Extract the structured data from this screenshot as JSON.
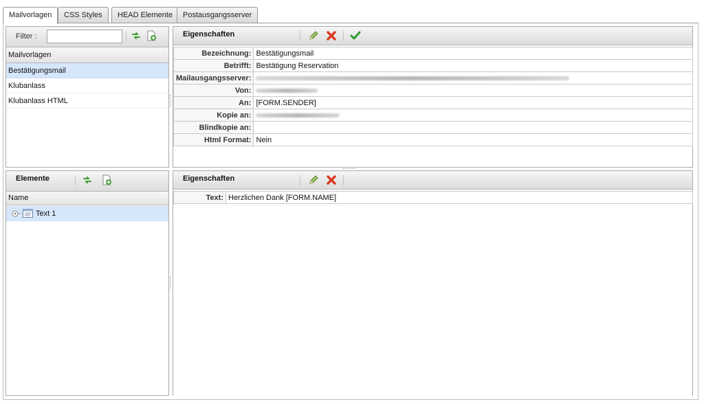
{
  "tabs": [
    {
      "label": "Mailvorlagen",
      "active": true
    },
    {
      "label": "CSS Styles",
      "active": false
    },
    {
      "label": "HEAD Elemente",
      "active": false
    },
    {
      "label": "Postausgangsserver",
      "active": false
    }
  ],
  "templates_panel": {
    "filter_label": "Filter :",
    "filter_value": "",
    "column_header": "Mailvorlagen",
    "items": [
      "Bestätigungsmail",
      "Klubanlass",
      "Klubanlass HTML"
    ],
    "selected_index": 0
  },
  "template_props": {
    "title": "Eigenschaften",
    "rows": [
      {
        "key": "Bezeichnung:",
        "value": "Bestätigungsmail"
      },
      {
        "key": "Betrifft:",
        "value": "Bestätigung Reservation"
      },
      {
        "key": "Mailausgangsserver:",
        "value": ""
      },
      {
        "key": "Von:",
        "value": ""
      },
      {
        "key": "An:",
        "value": "[FORM.SENDER]"
      },
      {
        "key": "Kopie an:",
        "value": ""
      },
      {
        "key": "Blindkopie an:",
        "value": ""
      },
      {
        "key": "Html Format:",
        "value": "Nein"
      }
    ]
  },
  "elements_panel": {
    "title": "Elemente",
    "column_header": "Name",
    "tree": [
      {
        "label": "Text 1"
      }
    ]
  },
  "element_props": {
    "title": "Eigenschaften",
    "rows": [
      {
        "key": "Text:",
        "value": "Herzlichen Dank [FORM.NAME]"
      }
    ]
  },
  "icons": {
    "refresh": "refresh-icon",
    "add": "add-page-icon",
    "edit": "pencil-icon",
    "delete": "delete-x-icon",
    "save": "checkmark-icon",
    "tree_toggle": "tree-toggle-icon",
    "text_node": "text-node-icon"
  },
  "colors": {
    "selection": "#d6e6fb",
    "refresh_green": "#3f9d2f",
    "delete_red": "#d9381e",
    "check_green": "#2e9a2b"
  }
}
